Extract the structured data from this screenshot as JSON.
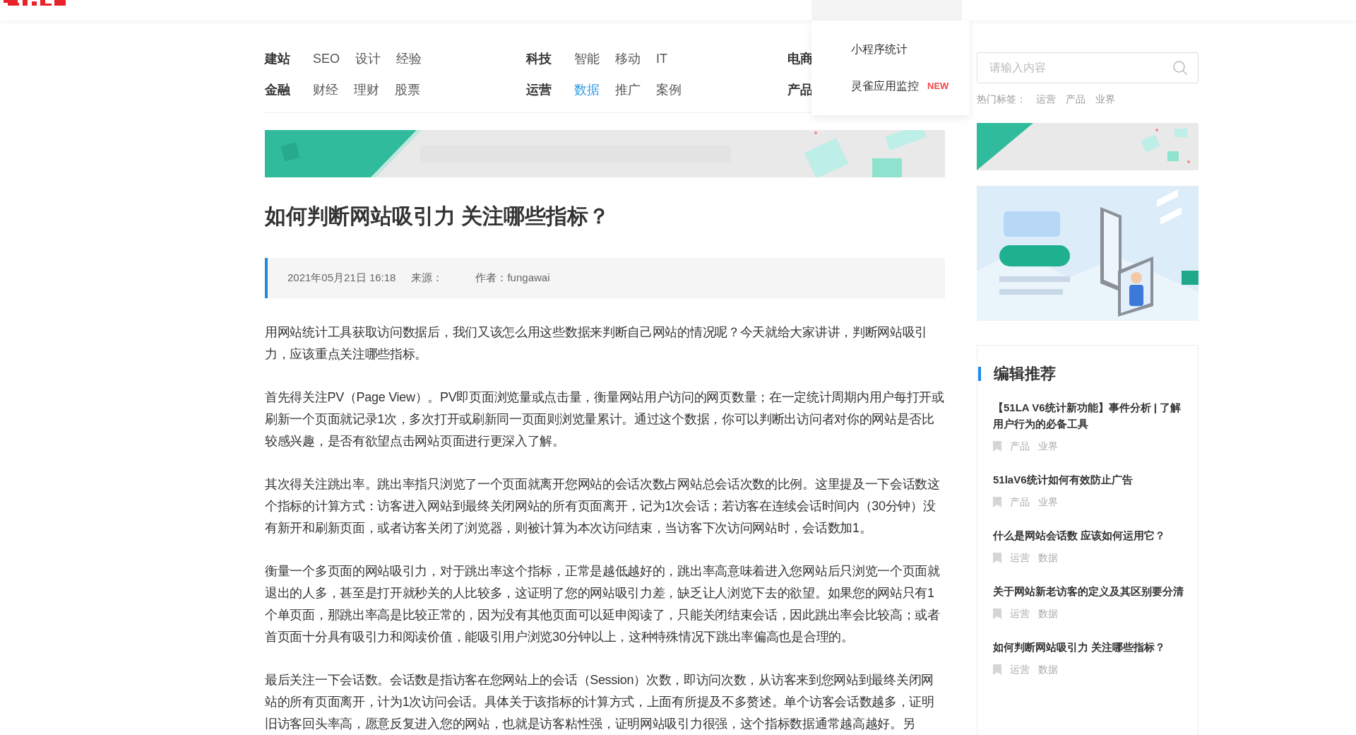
{
  "category_rows": [
    [
      {
        "label": "建站",
        "items": [
          {
            "label": "SEO",
            "selected": false
          },
          {
            "label": "设计",
            "selected": false
          },
          {
            "label": "经验",
            "selected": false
          }
        ]
      },
      {
        "label": "科技",
        "items": [
          {
            "label": "智能",
            "selected": false
          },
          {
            "label": "移动",
            "selected": false
          },
          {
            "label": "IT",
            "selected": false
          }
        ]
      },
      {
        "label": "电商"
      }
    ],
    [
      {
        "label": "金融",
        "items": [
          {
            "label": "财经",
            "selected": false
          },
          {
            "label": "理财",
            "selected": false
          },
          {
            "label": "股票",
            "selected": false
          }
        ]
      },
      {
        "label": "运营",
        "items": [
          {
            "label": "数据",
            "selected": true
          },
          {
            "label": "推广",
            "selected": false
          },
          {
            "label": "案例",
            "selected": false
          }
        ]
      },
      {
        "label": "产品"
      }
    ]
  ],
  "dropdown_menu": {
    "items": [
      {
        "label": "小程序统计"
      },
      {
        "label": "灵雀应用监控",
        "badge": "NEW"
      }
    ]
  },
  "search": {
    "placeholder": "请输入内容"
  },
  "hot_tags": {
    "label": "热门标签：",
    "tags": [
      "运营",
      "产品",
      "业界"
    ]
  },
  "article": {
    "title": "如何判断网站吸引力 关注哪些指标？",
    "meta": {
      "date": "2021年05月21日 16:18",
      "source": "来源：",
      "author": "作者：fungawai"
    },
    "paragraphs": [
      "用网站统计工具获取访问数据后，我们又该怎么用这些数据来判断自己网站的情况呢？今天就给大家讲讲，判断网站吸引力，应该重点关注哪些指标。",
      "首先得关注PV（Page View）。PV即页面浏览量或点击量，衡量网站用户访问的网页数量；在一定统计周期内用户每打开或刷新一个页面就记录1次，多次打开或刷新同一页面则浏览量累计。通过这个数据，你可以判断出访问者对你的网站是否比较感兴趣，是否有欲望点击网站页面进行更深入了解。",
      "其次得关注跳出率。跳出率指只浏览了一个页面就离开您网站的会话次数占网站总会话次数的比例。这里提及一下会话数这个指标的计算方式：访客进入网站到最终关闭网站的所有页面离开，记为1次会话；若访客在连续会话时间内（30分钟）没有新开和刷新页面，或者访客关闭了浏览器，则被计算为本次访问结束，当访客下次访问网站时，会话数加1。",
      "衡量一个多页面的网站吸引力，对于跳出率这个指标，正常是越低越好的，跳出率高意味着进入您网站后只浏览一个页面就退出的人多，甚至是打开就秒关的人比较多，这证明了您的网站吸引力差，缺乏让人浏览下去的欲望。如果您的网站只有1个单页面，那跳出率高是比较正常的，因为没有其他页面可以延申阅读了，只能关闭结束会话，因此跳出率会比较高；或者首页面十分具有吸引力和阅读价值，能吸引用户浏览30分钟以上，这种特殊情况下跳出率偏高也是合理的。",
      "最后关注一下会话数。会话数是指访客在您网站上的会话（Session）次数，即访问次数，从访客来到您网站到最终关闭网站的所有页面离开，计为1次访问会话。具体关于该指标的计算方式，上面有所提及不多赘述。单个访客会话数越多，证明旧访客回头率高，愿意反复进入您的网站，也就是访客粘性强，证明网站吸引力很强，这个指标数据通常越高越好。另"
    ]
  },
  "sidebar": {
    "heading": "编辑推荐",
    "items": [
      {
        "title": "【51LA V6统计新功能】事件分析 | 了解用户行为的必备工具",
        "tags": [
          "产品",
          "业界"
        ]
      },
      {
        "title": "51laV6统计如何有效防止广告",
        "tags": [
          "产品",
          "业界"
        ]
      },
      {
        "title": "什么是网站会话数 应该如何运用它？",
        "tags": [
          "运营",
          "数据"
        ]
      },
      {
        "title": "关于网站新老访客的定义及其区别要分清",
        "tags": [
          "运营",
          "数据"
        ]
      },
      {
        "title": "如何判断网站吸引力 关注哪些指标？",
        "tags": [
          "运营",
          "数据"
        ]
      }
    ]
  }
}
